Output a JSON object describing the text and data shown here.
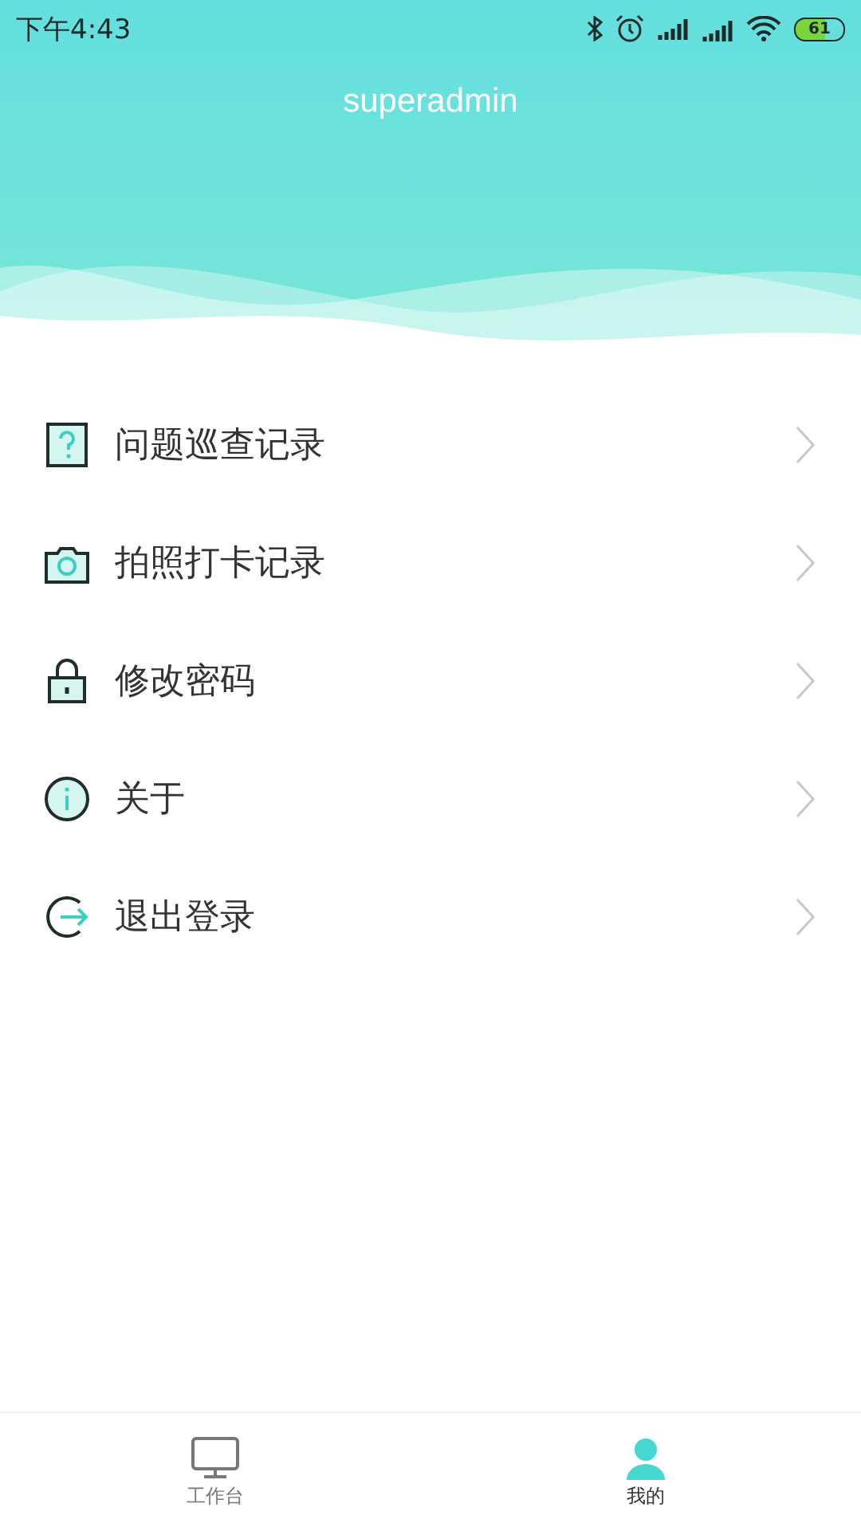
{
  "status_bar": {
    "time": "下午4:43",
    "battery": "61"
  },
  "header": {
    "username": "superadmin"
  },
  "menu": [
    {
      "kind": "question",
      "label": "问题巡查记录"
    },
    {
      "kind": "camera",
      "label": "拍照打卡记录"
    },
    {
      "kind": "lock",
      "label": "修改密码"
    },
    {
      "kind": "info",
      "label": "关于"
    },
    {
      "kind": "logout",
      "label": "退出登录"
    }
  ],
  "tabs": [
    {
      "kind": "desk",
      "label": "工作台",
      "selected": false
    },
    {
      "kind": "user",
      "label": "我的",
      "selected": true
    }
  ]
}
